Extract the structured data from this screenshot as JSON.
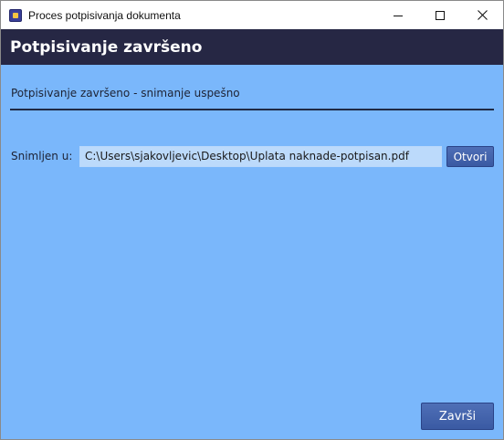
{
  "window": {
    "title": "Proces potpisivanja dokumenta",
    "controls": {
      "minimize": "minimize-icon",
      "maximize": "maximize-icon",
      "close": "close-icon"
    }
  },
  "header": {
    "title": "Potpisivanje završeno"
  },
  "main": {
    "status_text": "Potpisivanje završeno - snimanje uspešno",
    "saved_label": "Snimljen u:",
    "saved_path": "C:\\Users\\sjakovljevic\\Desktop\\Uplata naknade-potpisan.pdf",
    "open_button_label": "Otvori"
  },
  "footer": {
    "finish_button_label": "Završi"
  },
  "colors": {
    "background": "#7ab7fb",
    "header_bar": "#262744",
    "button": "#3a5aa3",
    "path_field": "#bcdafb"
  }
}
